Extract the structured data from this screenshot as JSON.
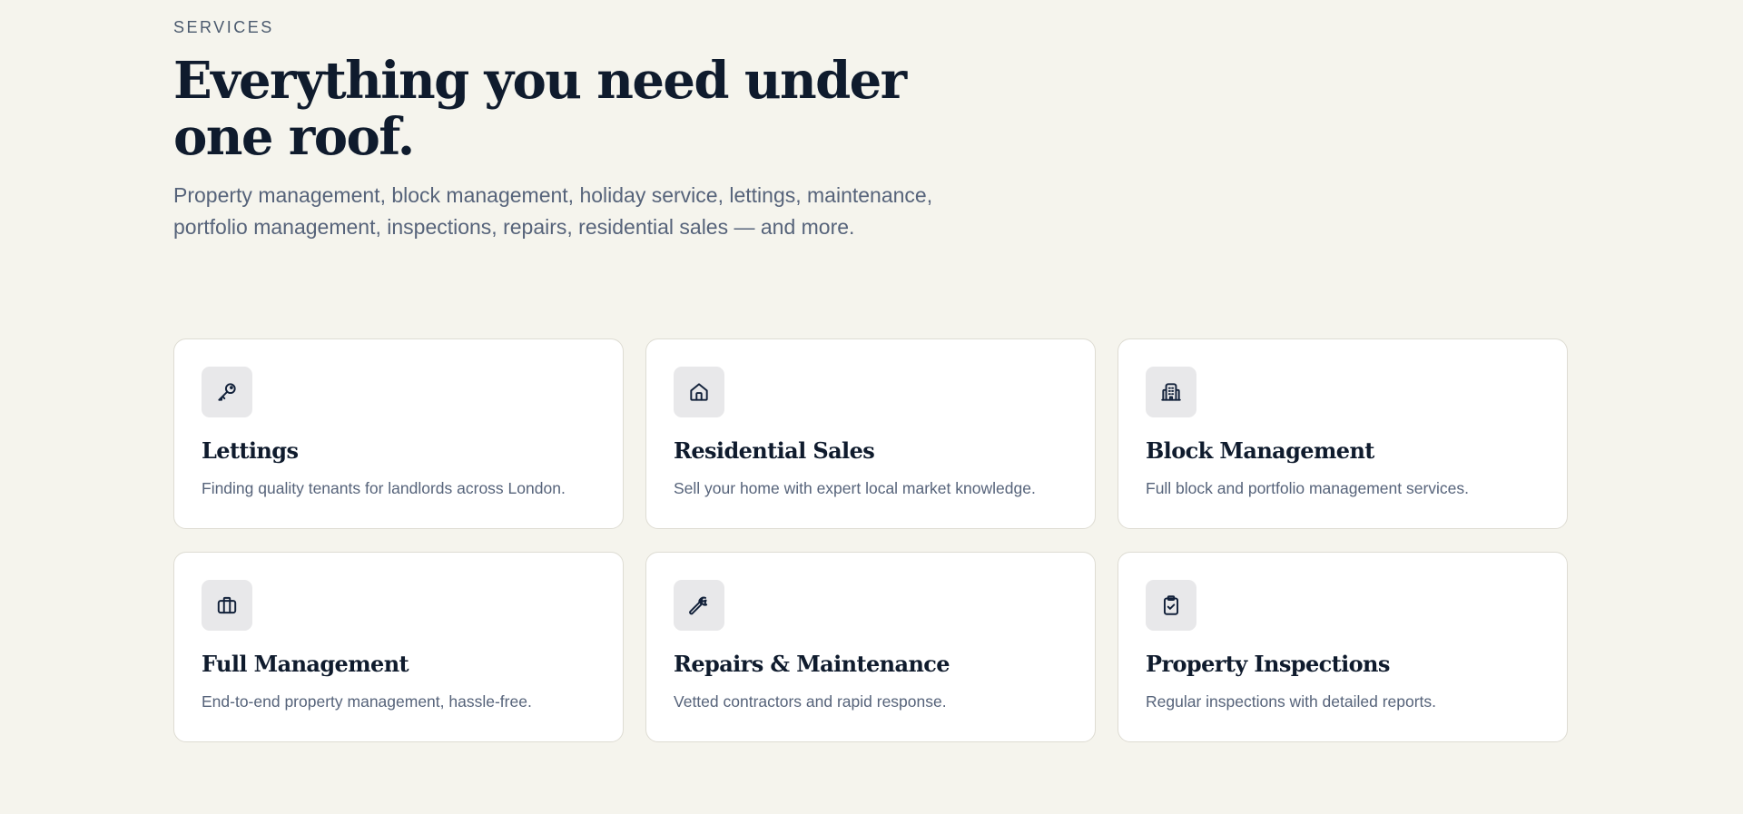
{
  "services": {
    "eyebrow": "SERVICES",
    "headline": "Everything you need under one roof.",
    "intro": "Property management, block management, holiday service, lettings, maintenance, portfolio management, inspections, repairs, residential sales — and more.",
    "cards": [
      {
        "icon": "key-icon",
        "title": "Lettings",
        "description": "Finding quality tenants for landlords across London."
      },
      {
        "icon": "house-icon",
        "title": "Residential Sales",
        "description": "Sell your home with expert local market knowledge."
      },
      {
        "icon": "building-icon",
        "title": "Block Management",
        "description": "Full block and portfolio management services."
      },
      {
        "icon": "briefcase-icon",
        "title": "Full Management",
        "description": "End-to-end property management, hassle-free."
      },
      {
        "icon": "wrench-icon",
        "title": "Repairs & Maintenance",
        "description": "Vetted contractors and rapid response."
      },
      {
        "icon": "clipboard-check-icon",
        "title": "Property Inspections",
        "description": "Regular inspections with detailed reports."
      }
    ]
  },
  "colors": {
    "background": "#f5f4ed",
    "card": "#ffffff",
    "icon_tile": "#e8e8ea",
    "heading": "#0f1b2d",
    "body_text": "#56637a"
  }
}
